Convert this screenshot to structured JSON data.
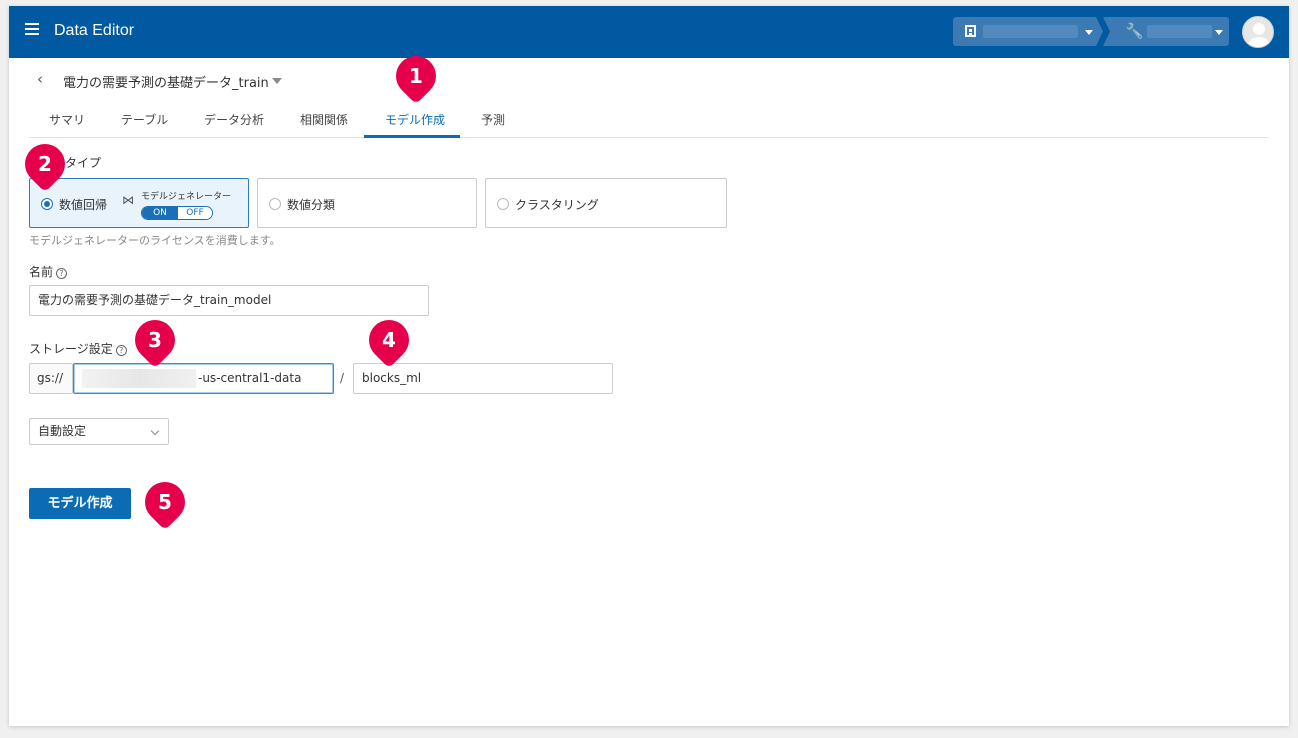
{
  "app": {
    "title": "Data Editor"
  },
  "header": {
    "org_selector": {
      "value": ""
    },
    "project_selector": {
      "value": ""
    }
  },
  "dataset": {
    "title": "電力の需要予測の基礎データ_train"
  },
  "tabs": [
    {
      "label": "サマリ",
      "active": false
    },
    {
      "label": "テーブル",
      "active": false
    },
    {
      "label": "データ分析",
      "active": false
    },
    {
      "label": "相関関係",
      "active": false
    },
    {
      "label": "モデル作成",
      "active": true
    },
    {
      "label": "予測",
      "active": false
    }
  ],
  "model_type": {
    "label": "タイプ",
    "options": [
      {
        "label": "数値回帰",
        "selected": true
      },
      {
        "label": "数値分類",
        "selected": false
      },
      {
        "label": "クラスタリング",
        "selected": false
      }
    ],
    "generator": {
      "label": "モデルジェネレーター",
      "on_label": "ON",
      "off_label": "OFF",
      "state": "ON"
    },
    "hint": "モデルジェネレーターのライセンスを消費します。"
  },
  "name": {
    "label": "名前",
    "value": "電力の需要予測の基礎データ_train_model"
  },
  "storage": {
    "label": "ストレージ設定",
    "prefix": "gs://",
    "bucket_suffix": "-us-central1-data",
    "separator": "/",
    "path": "blocks_ml"
  },
  "auto_setting": {
    "value": "自動設定"
  },
  "submit_label": "モデル作成",
  "markers": [
    "1",
    "2",
    "3",
    "4",
    "5"
  ],
  "colors": {
    "header": "#0159a1",
    "accent": "#0b6bb4",
    "marker": "#e6004c"
  }
}
